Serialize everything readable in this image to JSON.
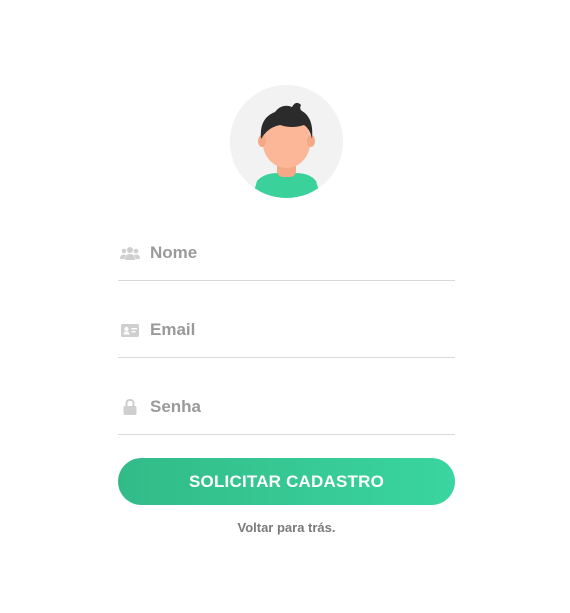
{
  "avatar": {
    "icon": "user-avatar-icon",
    "colors": {
      "background": "#f2f2f2",
      "skin": "#fbb797",
      "hair": "#2b2b2b",
      "shirt": "#3ad29a"
    }
  },
  "form": {
    "fields": [
      {
        "name": "nome",
        "placeholder": "Nome",
        "value": "",
        "icon": "users-icon"
      },
      {
        "name": "email",
        "placeholder": "Email",
        "value": "",
        "icon": "id-card-icon"
      },
      {
        "name": "senha",
        "placeholder": "Senha",
        "value": "",
        "icon": "lock-icon"
      }
    ],
    "submit_label": "SOLICITAR CADASTRO",
    "back_link": "Voltar para trás."
  },
  "colors": {
    "accent_start": "#32bb88",
    "accent_end": "#3ad5a0",
    "icon": "#cfcfcf",
    "placeholder": "#9a9a9a",
    "divider": "#d9d9d9"
  }
}
